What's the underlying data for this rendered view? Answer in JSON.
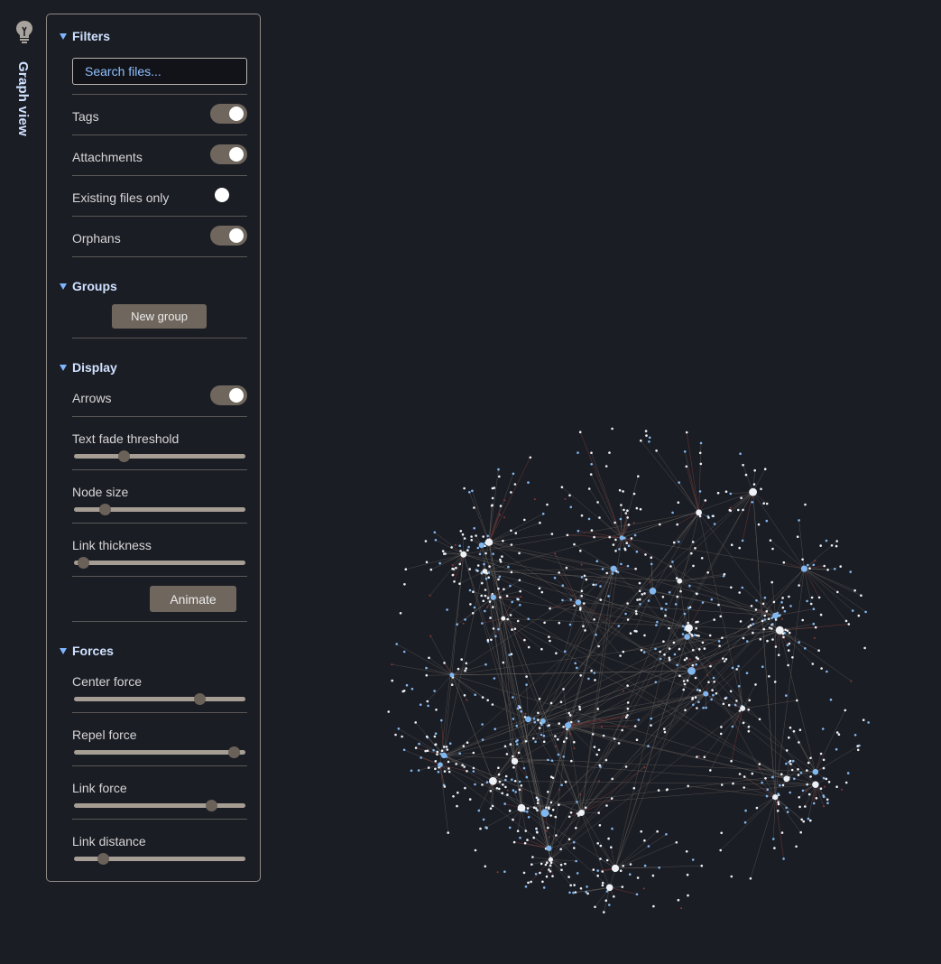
{
  "ribbon": {
    "title": "Graph view",
    "icon": "lightbulb-icon"
  },
  "filters": {
    "heading": "Filters",
    "search_placeholder": "Search files...",
    "rows": [
      {
        "label": "Tags",
        "on": true
      },
      {
        "label": "Attachments",
        "on": true
      },
      {
        "label": "Existing files only",
        "on": false
      },
      {
        "label": "Orphans",
        "on": true
      }
    ]
  },
  "groups": {
    "heading": "Groups",
    "new_group_label": "New group"
  },
  "display": {
    "heading": "Display",
    "arrows_label": "Arrows",
    "arrows_on": true,
    "sliders": [
      {
        "label": "Text fade threshold",
        "value": 0.29
      },
      {
        "label": "Node size",
        "value": 0.18
      },
      {
        "label": "Link thickness",
        "value": 0.05
      }
    ],
    "animate_label": "Animate"
  },
  "forces": {
    "heading": "Forces",
    "sliders": [
      {
        "label": "Center force",
        "value": 0.73
      },
      {
        "label": "Repel force",
        "value": 0.93
      },
      {
        "label": "Link force",
        "value": 0.8
      },
      {
        "label": "Link distance",
        "value": 0.17
      }
    ]
  },
  "colors": {
    "background": "#1b1d24",
    "accent": "#7eb6ff",
    "toggle_on": "#6f665d",
    "node_white": "#eef2f7",
    "node_blue": "#82b8f0",
    "link": "#6a6560",
    "link_red": "#8a3a36"
  }
}
